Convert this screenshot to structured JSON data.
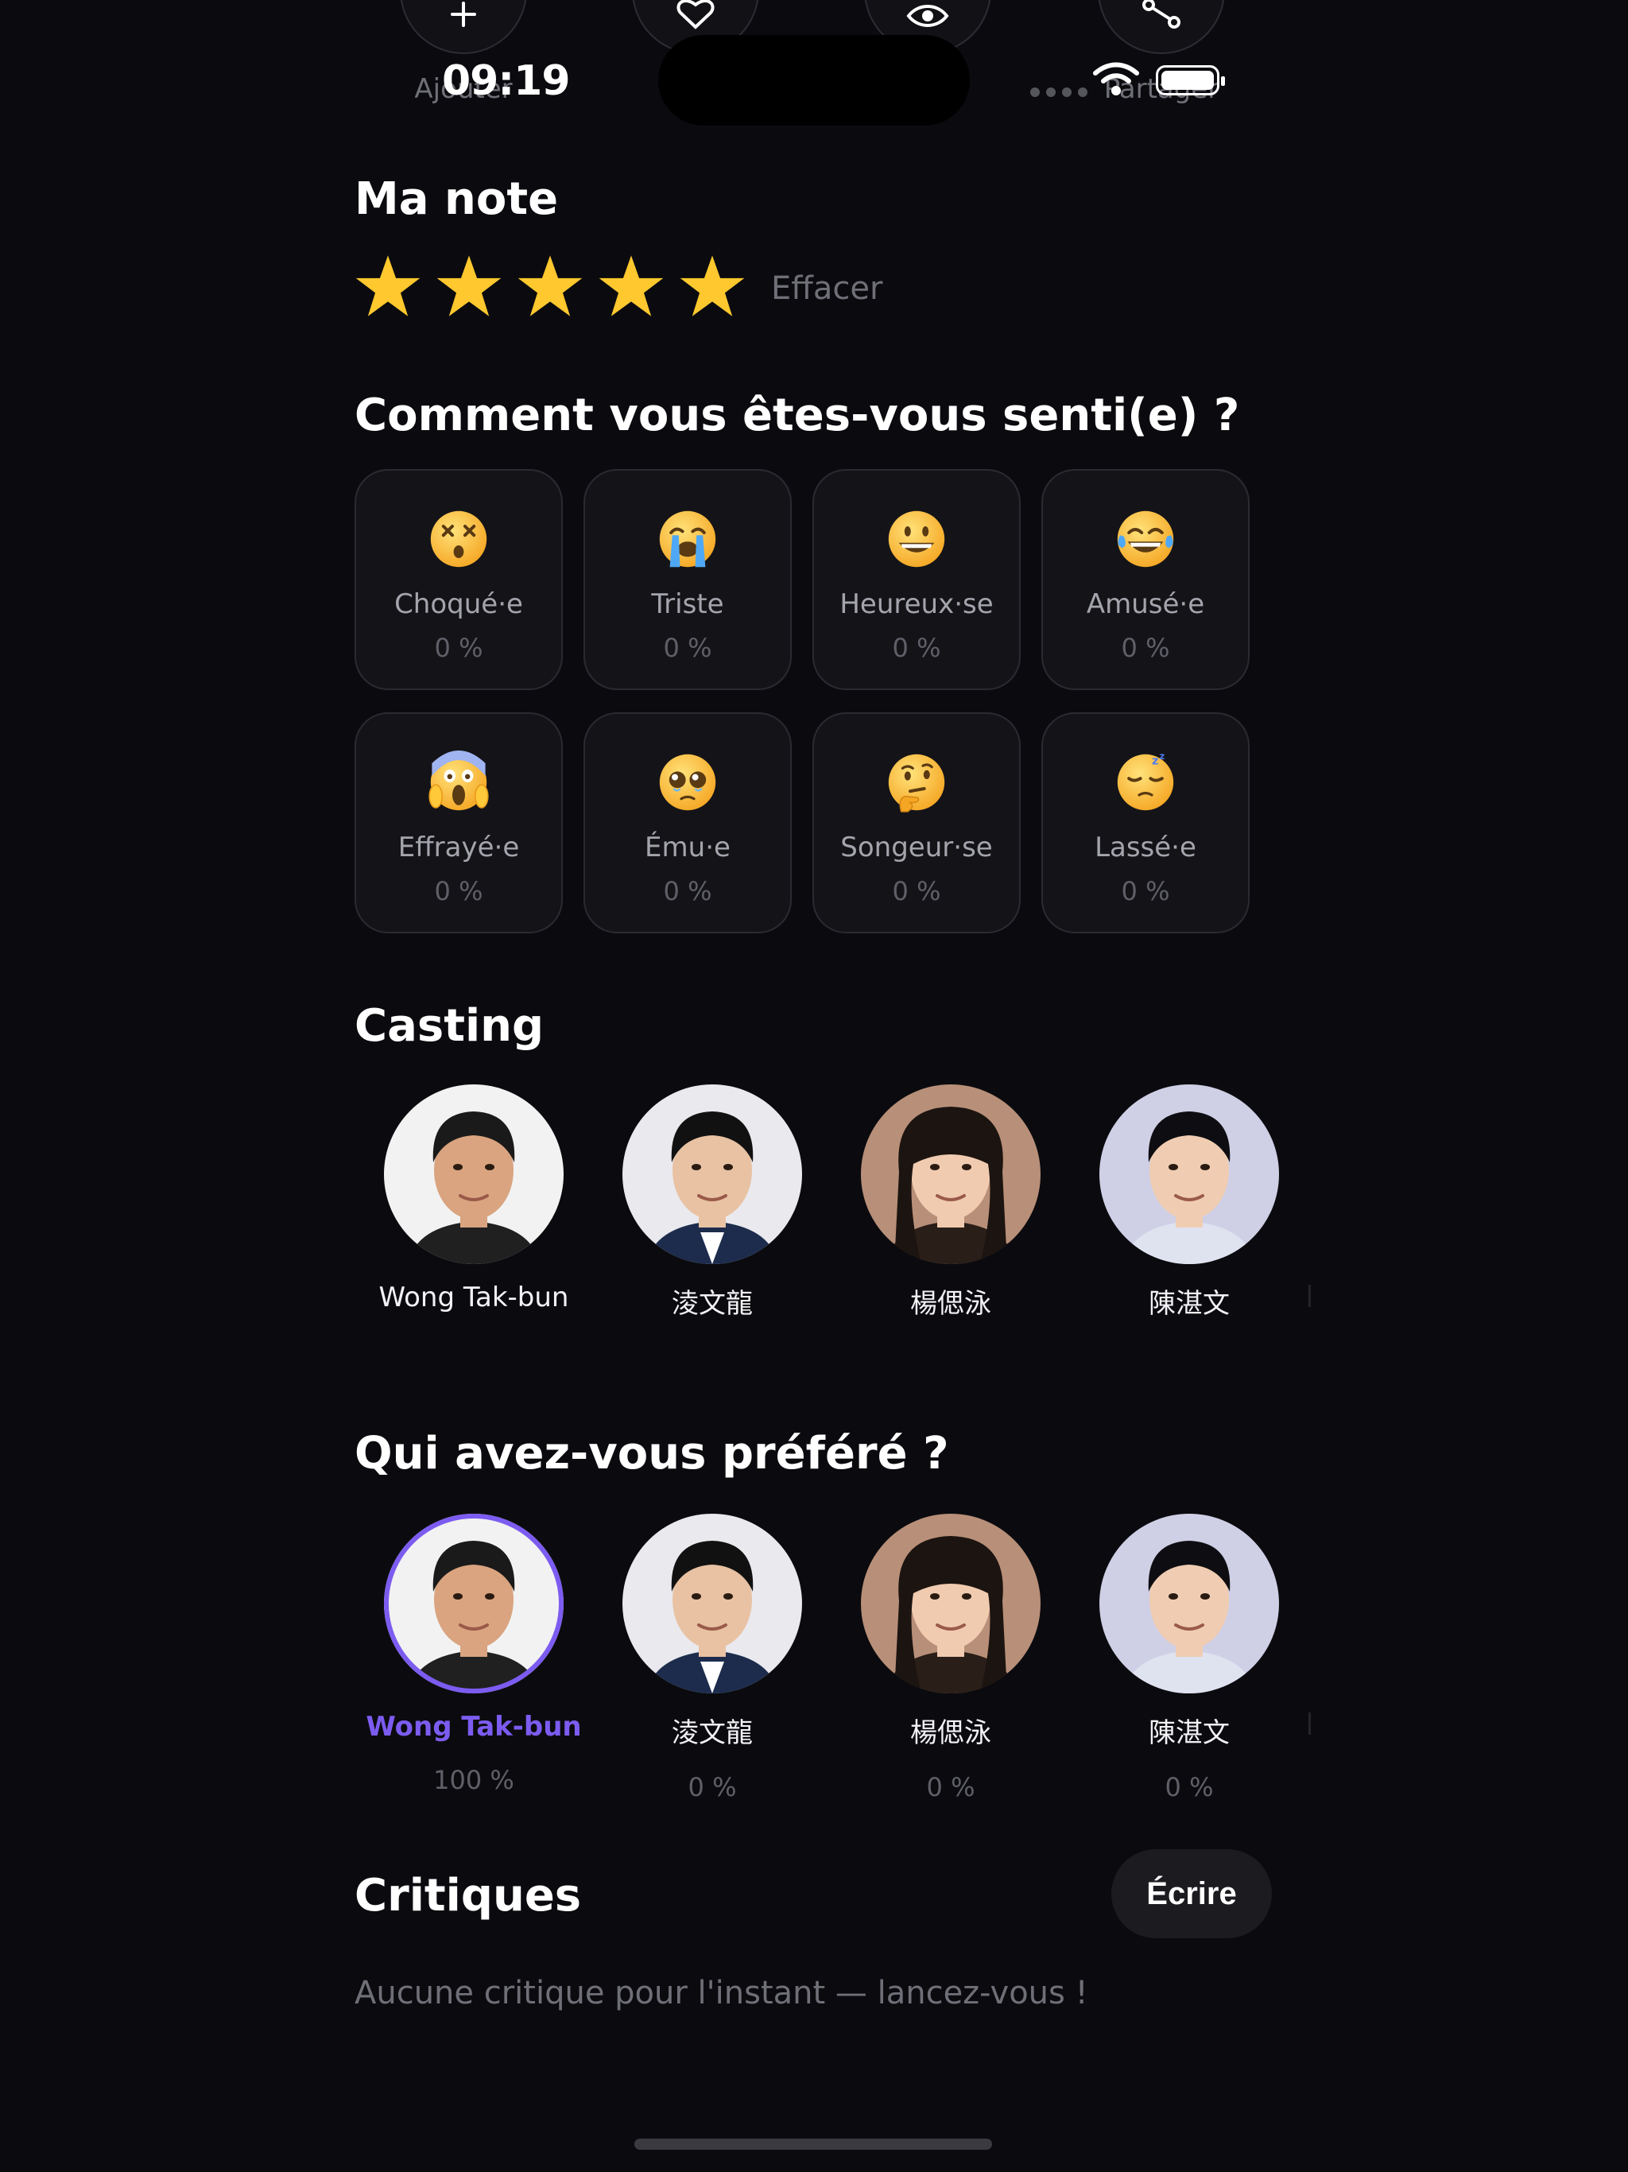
{
  "status_bar": {
    "time": "09:19"
  },
  "actions": [
    {
      "label": "Ajouter",
      "icon": "plus-icon"
    },
    {
      "label": "",
      "icon": "heart-icon"
    },
    {
      "label": "",
      "icon": "eye-icon"
    },
    {
      "label": "Partager",
      "icon": "share-icon"
    }
  ],
  "rating": {
    "title": "Ma note",
    "stars": 5,
    "max_stars": 5,
    "star_color": "#FFC82E",
    "clear_label": "Effacer"
  },
  "moods": {
    "title": "Comment vous êtes-vous senti(e) ?",
    "items": [
      {
        "emoji": "dizzy-face-emoji",
        "label": "Choqué·e",
        "pct": "0 %"
      },
      {
        "emoji": "crying-face-emoji",
        "label": "Triste",
        "pct": "0 %"
      },
      {
        "emoji": "grinning-face-emoji",
        "label": "Heureux·se",
        "pct": "0 %"
      },
      {
        "emoji": "tears-of-joy-emoji",
        "label": "Amusé·e",
        "pct": "0 %"
      },
      {
        "emoji": "screaming-face-emoji",
        "label": "Effrayé·e",
        "pct": "0 %"
      },
      {
        "emoji": "pleading-face-emoji",
        "label": "Ému·e",
        "pct": "0 %"
      },
      {
        "emoji": "thinking-face-emoji",
        "label": "Songeur·se",
        "pct": "0 %"
      },
      {
        "emoji": "sleepy-face-emoji",
        "label": "Lassé·e",
        "pct": "0 %"
      }
    ]
  },
  "casting": {
    "title": "Casting",
    "people": [
      {
        "name": "Wong Tak-bun"
      },
      {
        "name": "淩文龍"
      },
      {
        "name": "楊偲泳"
      },
      {
        "name": "陳湛文"
      }
    ]
  },
  "favorite": {
    "title": "Qui avez-vous préféré ?",
    "accent": "#7C5CF0",
    "people": [
      {
        "name": "Wong Tak-bun",
        "pct": "100 %",
        "selected": true
      },
      {
        "name": "淩文龍",
        "pct": "0 %",
        "selected": false
      },
      {
        "name": "楊偲泳",
        "pct": "0 %",
        "selected": false
      },
      {
        "name": "陳湛文",
        "pct": "0 %",
        "selected": false
      }
    ]
  },
  "reviews": {
    "title": "Critiques",
    "write_label": "Écrire",
    "empty_text": "Aucune critique pour l'instant — lancez-vous !"
  }
}
